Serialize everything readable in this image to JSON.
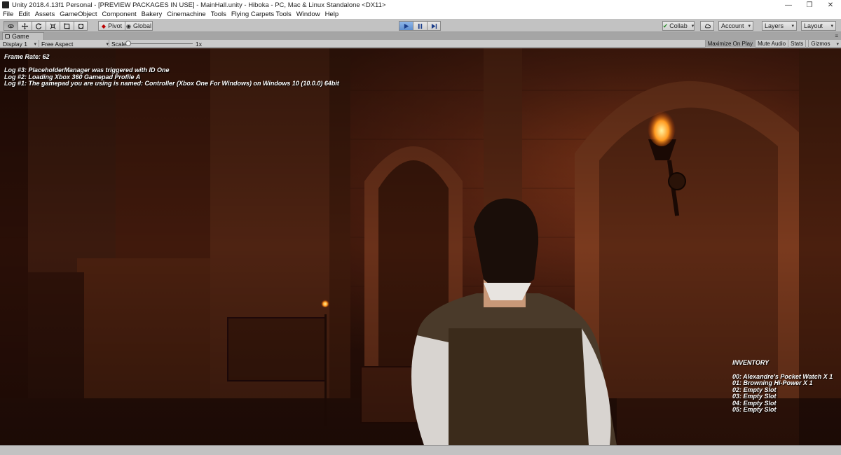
{
  "window": {
    "title": "Unity 2018.4.13f1 Personal - [PREVIEW PACKAGES IN USE] - MainHall.unity - Hiboka - PC, Mac & Linux Standalone <DX11>",
    "minimize_glyph": "—",
    "restore_glyph": "❐",
    "close_glyph": "✕"
  },
  "menu": [
    "File",
    "Edit",
    "Assets",
    "GameObject",
    "Component",
    "Bakery",
    "Cinemachine",
    "Tools",
    "Flying Carpets Tools",
    "Window",
    "Help"
  ],
  "toolbar": {
    "transform_tools": [
      "hand-icon",
      "move-icon",
      "rotate-icon",
      "scale-icon",
      "rect-icon",
      "transform-icon"
    ],
    "pivot_label": "Pivot",
    "global_label": "Global",
    "play_controls": [
      "play-icon",
      "pause-icon",
      "step-icon"
    ],
    "collab_label": "Collab",
    "account_label": "Account",
    "layers_label": "Layers",
    "layout_label": "Layout"
  },
  "game_tab": {
    "label": "Game"
  },
  "game_toolbar": {
    "display": "Display 1",
    "aspect": "Free Aspect",
    "scale_label": "Scale",
    "scale_value": "1x",
    "scale_level": 0.0,
    "maximize_on_play": "Maximize On Play",
    "mute_audio": "Mute Audio",
    "stats": "Stats",
    "gizmos": "Gizmos"
  },
  "overlay": {
    "frame_rate": "Frame Rate: 62",
    "logs": [
      "Log #3: PlaceholderManager was triggered with ID One",
      "Log #2: Loading Xbox 360 Gamepad Profile A",
      "Log #1: The gamepad you are using is named: Controller (Xbox One For Windows) on Windows 10  (10.0.0) 64bit"
    ]
  },
  "inventory": {
    "title": "INVENTORY",
    "slots": [
      "00: Alexandre's Pocket Watch X 1",
      "01: Browning Hi-Power X 1",
      "02: Empty Slot",
      "03: Empty Slot",
      "04: Empty Slot",
      "05: Empty Slot"
    ]
  },
  "colors": {
    "play_active": "#5f8fd0",
    "editor_gray": "#c2c2c2",
    "scene_wall": "#5a2a1a",
    "torch_flame": "#ff8a1a"
  }
}
